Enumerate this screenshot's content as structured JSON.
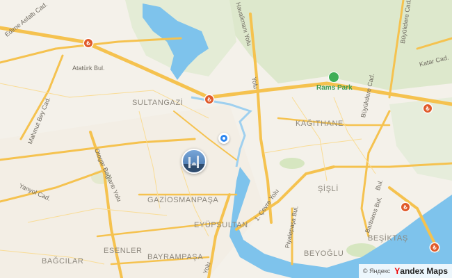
{
  "map": {
    "labels": {
      "sultangazi": "SULTANGAZİ",
      "kagithane": "KAĞITHANE",
      "sisli": "ŞİŞLİ",
      "gaziosmanpasa": "GAZİOSMANPAŞA",
      "eyupsultan": "EYÜPSULTAN",
      "besiktas": "BEŞİKTAŞ",
      "beyoglu": "BEYOĞLU",
      "esenler": "ESENLER",
      "bagcilar": "BAĞCILAR",
      "bayrampasa": "BAYRAMPAŞA"
    },
    "streets": {
      "edirne": "Edirne Asfaltı Cad.",
      "ataturk": "Atatürk Bul.",
      "mahmutbey": "Mahmut Bey Cad.",
      "otogar": "Otogar Bağlantı Yolu",
      "yanyol": "Yanyol Cad.",
      "havalimani": "Havalimanı Yolu",
      "yolu_right": "Yolu",
      "yolu_bottom": "Yolu",
      "cevre": "1. Çevre Yolu",
      "piyalepasa": "Piyalepaşa Bul.",
      "barbaros": "Barbaros Bul.",
      "bul_right": "Bul.",
      "buyukdere1": "Büyükdere Cad.",
      "buyukdere2": "Büyükdere Cad.",
      "katar": "Katar Cad."
    },
    "poi": {
      "rams_park": "Rams Park"
    },
    "toll_symbol": "₺",
    "attribution": {
      "copyright": "© Яндекс",
      "brand_first": "Y",
      "brand_rest": "andex Maps"
    },
    "colors": {
      "road": "#f5c24f",
      "water": "#7ec3ec",
      "park": "#cfe3b4",
      "location": "#2d86f0",
      "toll": "#e05a2a"
    }
  }
}
